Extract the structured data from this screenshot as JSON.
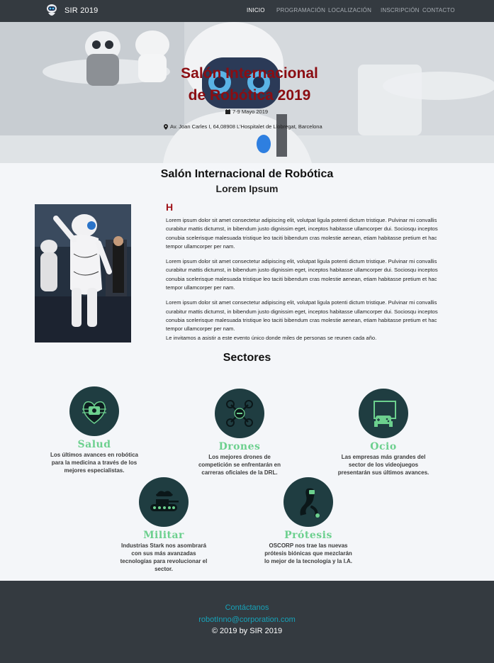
{
  "navbar": {
    "brand": "SIR 2019",
    "links": [
      {
        "label": "INICIO",
        "active": true
      },
      {
        "label": "PROGRAMACIÓN",
        "active": false
      },
      {
        "label": "LOCALIZACIÓN",
        "active": false
      },
      {
        "label": "INSCRIPCIÓN",
        "active": false
      },
      {
        "label": "CONTACTO",
        "active": false
      }
    ]
  },
  "hero": {
    "title_line1": "Salón Internacional",
    "title_line2": "de Robótica 2019",
    "date": "7-9 Mayo 2019",
    "address": "Av. Joan Carles I, 64,08908 L'Hospitalet de Llobregat, Barcelona"
  },
  "intro": {
    "title": "Salón Internacional de Robótica",
    "subtitle": "Lorem Ipsum",
    "heading": "H",
    "paragraphs": [
      "Lorem ipsum dolor sit amet consectetur adipiscing elit, volutpat ligula potenti dictum tristique. Pulvinar mi convallis curabitur mattis dictumst, in bibendum justo dignissim eget, inceptos habitasse ullamcorper dui. Sociosqu inceptos conubia scelerisque malesuada tristique leo taciti bibendum cras molestie aenean, etiam habitasse pretium et hac tempor ullamcorper per nam.",
      "Lorem ipsum dolor sit amet consectetur adipiscing elit, volutpat ligula potenti dictum tristique. Pulvinar mi convallis curabitur mattis dictumst, in bibendum justo dignissim eget, inceptos habitasse ullamcorper dui. Sociosqu inceptos conubia scelerisque malesuada tristique leo taciti bibendum cras molestie aenean, etiam habitasse pretium et hac tempor ullamcorper per nam.",
      "Lorem ipsum dolor sit amet consectetur adipiscing elit, volutpat ligula potenti dictum tristique. Pulvinar mi convallis curabitur mattis dictumst, in bibendum justo dignissim eget, inceptos habitasse ullamcorper dui. Sociosqu inceptos conubia scelerisque malesuada tristique leo taciti bibendum cras molestie aenean, etiam habitasse pretium et hac tempor ullamcorper per nam."
    ],
    "invite": "Le invitamos a asistir a este evento único donde miles de personas se reunen cada año."
  },
  "sectores": {
    "title": "Sectores",
    "items": [
      {
        "name": "Salud",
        "icon": "heart-chip-icon",
        "desc": "Los últimos avances en robótica para la medicina a través de los mejores especialistas."
      },
      {
        "name": "Drones",
        "icon": "drone-icon",
        "desc": "Los mejores drones de competición se enfrentarán en carreras oficiales de la DRL."
      },
      {
        "name": "Ocio",
        "icon": "gamepad-icon",
        "desc": "Las empresas más grandes del sector de los videojuegos presentarán sus últimos avances."
      },
      {
        "name": "Militar",
        "icon": "tank-icon",
        "desc": "Industrias Stark nos asombrará con sus más avanzadas tecnologías para revolucionar el sector."
      },
      {
        "name": "Prótesis",
        "icon": "prosthetic-arm-icon",
        "desc": "OSCORP nos trae las nuevas prótesis biónicas que mezclarán lo mejor de la tecnología y la I.A."
      }
    ]
  },
  "footer": {
    "contact": "Contáctanos",
    "email": "robotInno@corporation.com",
    "copyright": "© 2019 by SIR 2019"
  },
  "colors": {
    "navbar_bg": "#343a40",
    "hero_title": "#8b0d12",
    "sector_name": "#6cd08e",
    "sector_icon_bg": "#1f3d41",
    "footer_link": "#17a2b8"
  }
}
